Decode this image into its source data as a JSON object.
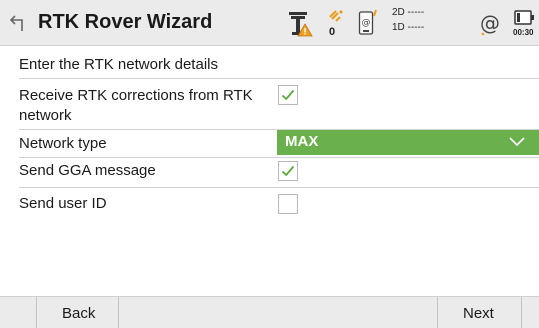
{
  "header": {
    "title": "RTK Rover Wizard",
    "satellites": "0",
    "dop_2d": "2D -----",
    "dop_1d": "1D -----",
    "time": "00:30",
    "icons": [
      "back-arrow-icon",
      "antenna-warning-icon",
      "satellite-icon",
      "device-connection-icon",
      "internet-icon",
      "battery-icon"
    ]
  },
  "content": {
    "heading": "Enter the RTK network details",
    "receive_corrections": {
      "label_line1": "Receive RTK corrections from RTK",
      "label_line2": "network",
      "checked": true
    },
    "network_type": {
      "label": "Network type",
      "value": "MAX"
    },
    "send_gga": {
      "label": "Send GGA message",
      "checked": true
    },
    "send_user_id": {
      "label": "Send user ID",
      "checked": false
    }
  },
  "footer": {
    "back_label": "Back",
    "next_label": "Next"
  },
  "colors": {
    "accent_green": "#6ab04c",
    "check_green": "#5aa83a",
    "bar_gray": "#ebebeb"
  }
}
